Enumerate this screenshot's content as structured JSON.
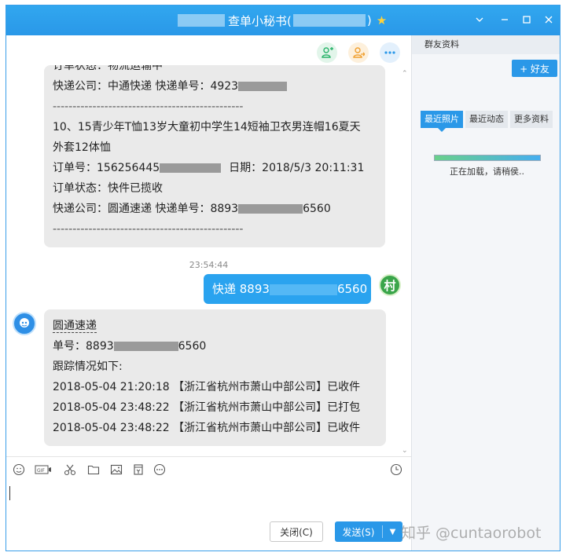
{
  "window": {
    "title_prefix": "查单小秘书(",
    "title_suffix": ")"
  },
  "chat": {
    "bubble1": {
      "status_line": "订单状态：物流运输中",
      "express_prefix": "快递公司：中通快递  快递单号：4923",
      "dashes1": "------------------------------------------------",
      "item_line1": "10、15青少年T恤13岁大童初中学生14短袖卫衣男连帽16夏天",
      "item_line2": "外套12体恤",
      "order_prefix": "订单号：156256445",
      "order_date": "日期：2018/5/3 20:11:31",
      "status_line2": "订单状态：快件已揽收",
      "express_prefix2": "快递公司：圆通速递  快递单号：8893",
      "express_suffix2": "6560",
      "dashes2": "------------------------------------------------"
    },
    "timestamp": "23:54:44",
    "sent": {
      "prefix": "快递 8893",
      "suffix": "6560"
    },
    "avatar_right_char": "村",
    "bubble2": {
      "company": "圆通速递",
      "tracking_prefix": "单号：8893",
      "tracking_suffix": "6560",
      "tracking_header": "跟踪情况如下:",
      "events": [
        "2018-05-04 21:20:18 【浙江省杭州市萧山中部公司】已收件",
        "2018-05-04 23:48:22 【浙江省杭州市萧山中部公司】已打包",
        "2018-05-04 23:48:22 【浙江省杭州市萧山中部公司】已收件"
      ]
    }
  },
  "toolbar": {
    "icons": [
      "emoji-icon",
      "gif-icon",
      "scissors-icon",
      "folder-icon",
      "image-icon",
      "calendar-icon",
      "more-icon",
      "history-icon"
    ]
  },
  "buttons": {
    "close": "关闭(C)",
    "send": "发送(S)"
  },
  "side": {
    "header": "群友资料",
    "add_friend": "+ 好友",
    "tabs": [
      "最近照片",
      "最近动态",
      "更多资料"
    ],
    "progress": 1.0,
    "loading": "正在加载，请稍侯.."
  },
  "watermark": "知乎 @cuntaorobot",
  "colors": {
    "accent": "#2a98e8",
    "bubble_sent": "#2aa3ef",
    "bubble_received": "#eaeaea"
  }
}
